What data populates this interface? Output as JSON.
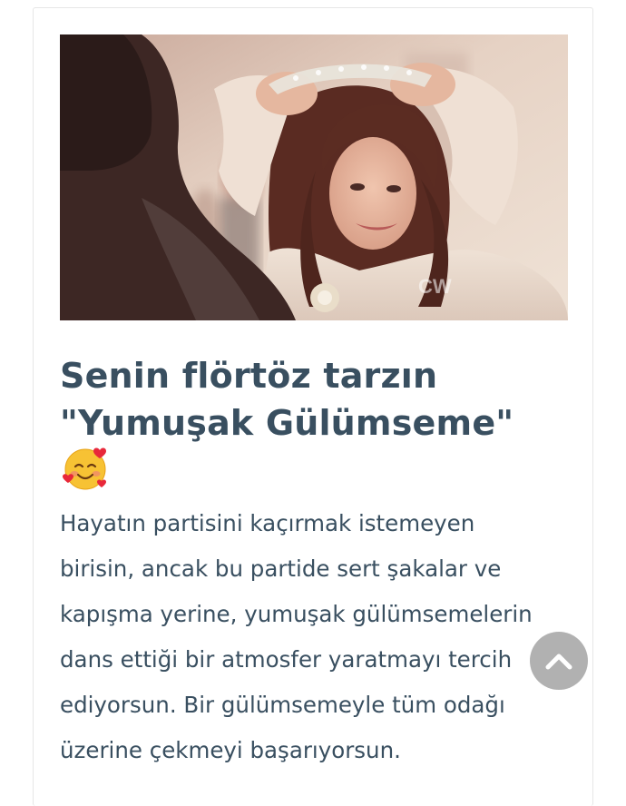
{
  "result": {
    "title_lines": [
      "Senin flörtöz tarzın",
      "\"Yumuşak Gülümseme\""
    ],
    "title_emoji": "smiling-face-with-hearts",
    "description_lines": [
      "Hayatın partisini kaçırmak istemeyen",
      "birisin, ancak bu partide sert şakalar ve",
      "kapışma yerine, yumuşak gülümsemelerin",
      "dans ettiği bir atmosfer yaratmayı tercih",
      "ediyorsun. Bir gülümsemeyle tüm odağı",
      "üzerine çekmeyi başarıyorsun."
    ],
    "image_watermark": "CW"
  },
  "scroll_top": {
    "icon": "chevron-up-icon"
  },
  "colors": {
    "text": "#394f60",
    "scroll_button": "#a0a0a0"
  }
}
